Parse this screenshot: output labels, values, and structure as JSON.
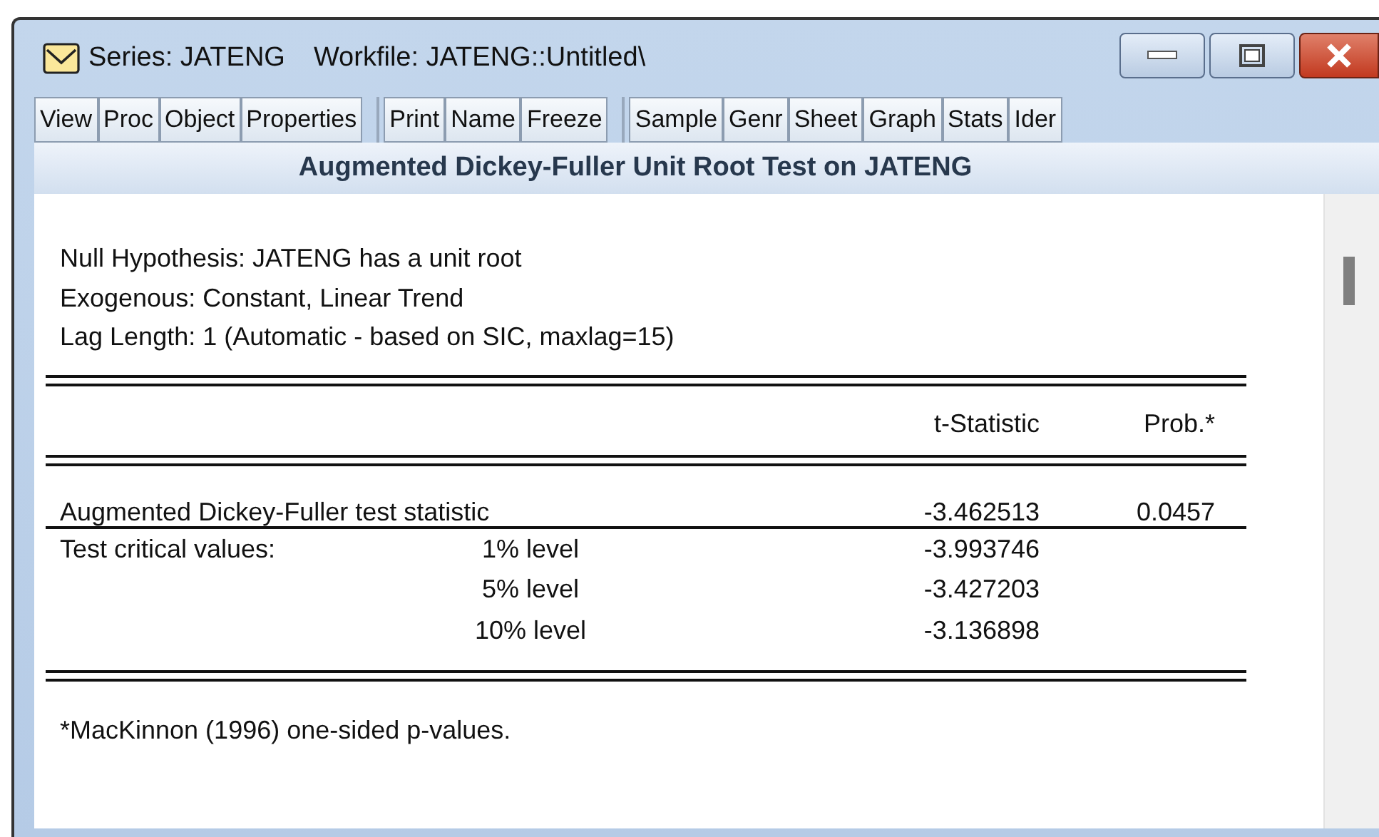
{
  "window": {
    "title": "Series: JATENG",
    "workfile": "Workfile: JATENG::Untitled\\"
  },
  "toolbar": [
    [
      "View",
      "Proc",
      "Object",
      "Properties"
    ],
    [
      "Print",
      "Name",
      "Freeze"
    ],
    [
      "Sample",
      "Genr",
      "Sheet",
      "Graph",
      "Stats",
      "Ider"
    ]
  ],
  "view_title": "Augmented Dickey-Fuller Unit Root Test on JATENG",
  "header_lines": [
    "Null Hypothesis: JATENG has a unit root",
    "Exogenous: Constant, Linear Trend",
    "Lag Length: 1 (Automatic - based on SIC, maxlag=15)"
  ],
  "table": {
    "columns": [
      "t-Statistic",
      "Prob.*"
    ],
    "test_row": {
      "label": "Augmented Dickey-Fuller test statistic",
      "t_statistic": "-3.462513",
      "prob": "0.0457"
    },
    "critical_values": {
      "label": "Test critical values:",
      "rows": [
        {
          "level": "1% level",
          "value": "-3.993746"
        },
        {
          "level": "5% level",
          "value": "-3.427203"
        },
        {
          "level": "10% level",
          "value": "-3.136898"
        }
      ]
    }
  },
  "footnote": "*MacKinnon (1996) one-sided p-values."
}
